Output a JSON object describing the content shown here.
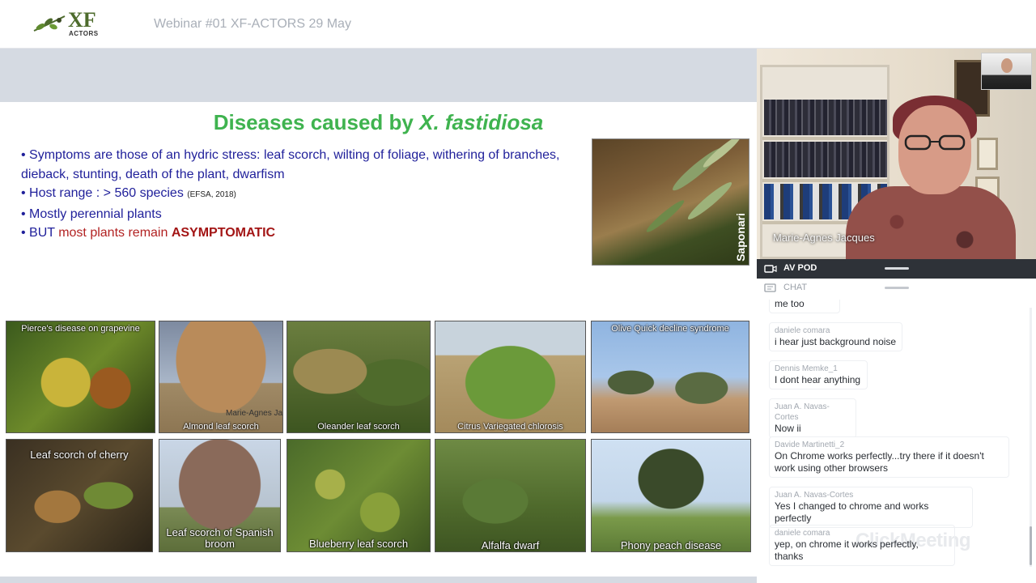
{
  "header": {
    "logo_text": "XF",
    "logo_subtext": "ACTORS",
    "webinar_title": "Webinar #01 XF-ACTORS 29 May"
  },
  "slide": {
    "title_main": "Diseases caused by ",
    "title_italic": "X. fastidiosa",
    "bullet1": "• Symptoms are those of an hydric stress: leaf scorch, wilting of foliage, withering of branches, dieback, stunting, death of the plant, dwarfism",
    "bullet2_main": "• Host range : > 560 species ",
    "bullet2_small": "(EFSA, 2018)",
    "bullet3": "• Mostly perennial plants",
    "bullet4_prefix": "• BUT ",
    "bullet4_red": "most plants remain ",
    "bullet4_bold": "ASYMPTOMATIC",
    "hero_credit": "Saponari",
    "tiles": {
      "t1": "Pierce's disease on grapevine",
      "t2": "Almond leaf scorch",
      "t2_overlay": "Marie-Agnes Jac",
      "t3": "Oleander leaf scorch",
      "t4": "Citrus Variegated chlorosis",
      "t5": "Olive Quick decline syndrome",
      "t6": "Leaf scorch of cherry",
      "t7": "Leaf scorch of Spanish broom",
      "t8": "Blueberry leaf scorch",
      "t9": "Alfalfa dwarf",
      "t10": "Phony peach disease"
    }
  },
  "video": {
    "speaker_name": "Marie-Agnes Jacques"
  },
  "panels": {
    "av_label": "AV POD",
    "chat_label": "CHAT"
  },
  "chat": {
    "messages": [
      {
        "author": "",
        "text": "me too"
      },
      {
        "author": "daniele comara",
        "text": "i hear just background noise"
      },
      {
        "author": "Dennis Memke_1",
        "text": "I dont hear anything"
      },
      {
        "author": "Juan A. Navas-Cortes",
        "text": "Now ii"
      },
      {
        "author": "Davide Martinetti_2",
        "text": "On Chrome works perfectly...try there if it doesn't work using other browsers"
      },
      {
        "author": "Juan A. Navas-Cortes",
        "text": "Yes I changed to chrome and works perfectly"
      },
      {
        "author": "daniele comara",
        "text": "yep, on chrome it works perfectly, thanks"
      }
    ],
    "watermark": "ClickMeeting"
  },
  "colors": {
    "title_green": "#3fb34f",
    "bullet_blue": "#1f1f9a",
    "accent_red": "#a31515",
    "av_bar": "#2e3238"
  }
}
